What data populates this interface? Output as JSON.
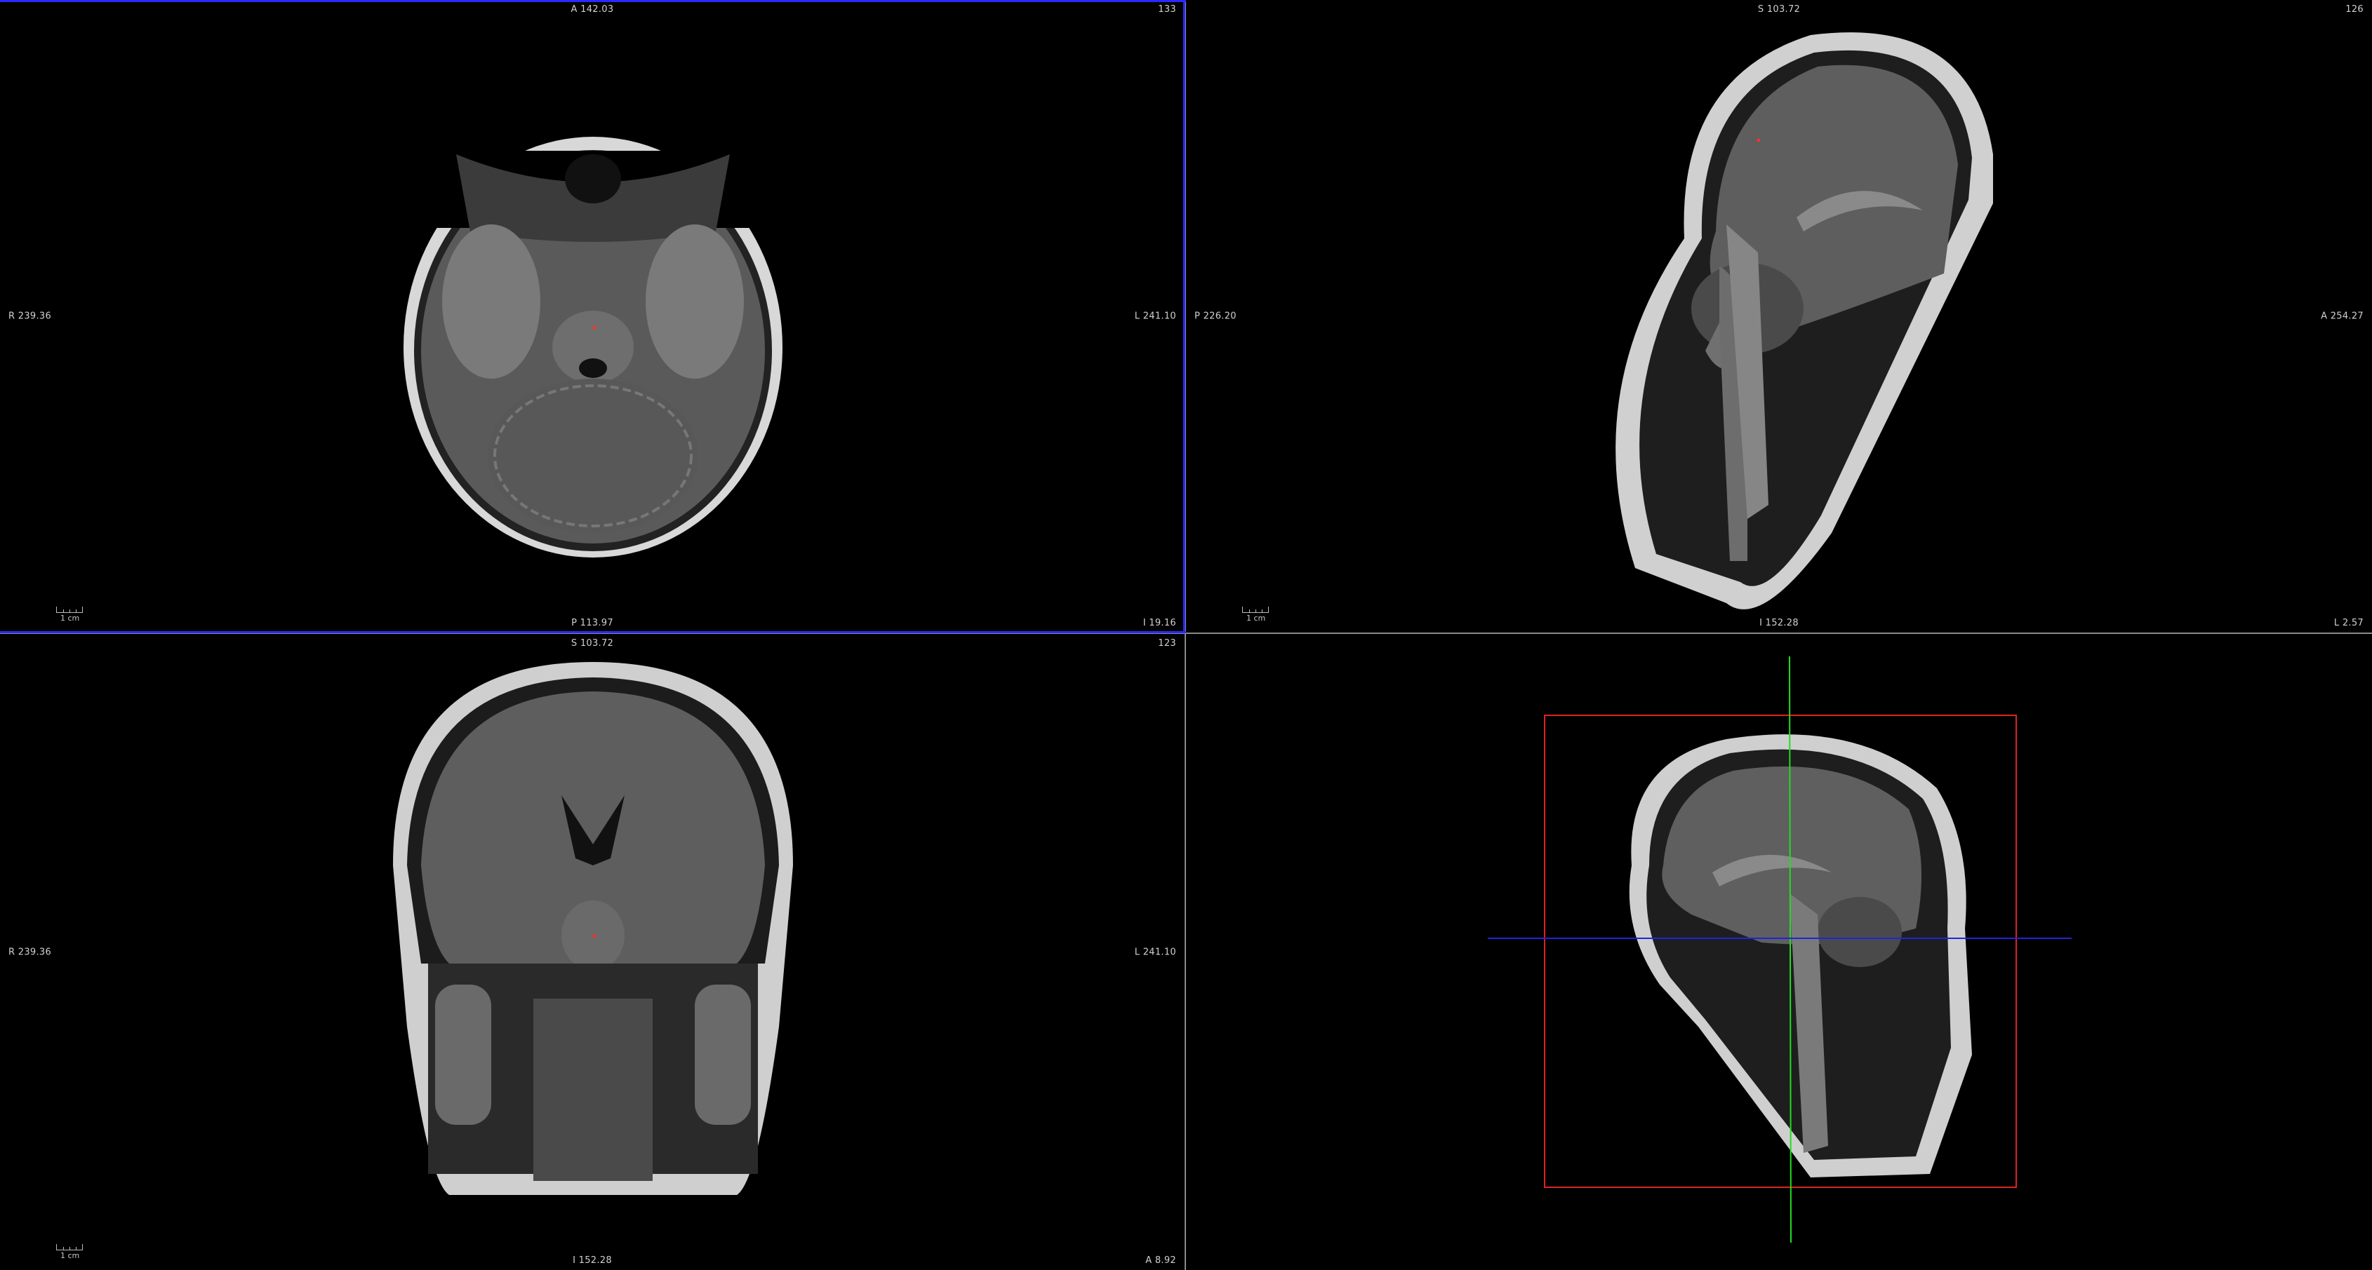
{
  "colors": {
    "background": "#000000",
    "separator": "#8a8a8a",
    "active_border": "#2a2aff",
    "crosshair_marker": "#ff3030",
    "bbox_3d": "#dd2222",
    "axis_green": "#22dd22",
    "axis_blue": "#2222dd"
  },
  "viewports": {
    "axial": {
      "top": "A 142.03",
      "bottom": "P 113.97",
      "left": "R 239.36",
      "right": "L 241.10",
      "slice_index": "133",
      "bottom_right": "I 19.16",
      "scale_label": "1 cm"
    },
    "sagittal": {
      "top": "S 103.72",
      "bottom": "I 152.28",
      "left": "P 226.20",
      "right": "A 254.27",
      "slice_index": "126",
      "bottom_right": "L 2.57",
      "scale_label": "1 cm"
    },
    "coronal": {
      "top": "S 103.72",
      "bottom": "I 152.28",
      "left": "R 239.36",
      "right": "L 241.10",
      "slice_index": "123",
      "bottom_right": "A 8.92",
      "scale_label": "1 cm"
    },
    "volume3d": {}
  }
}
